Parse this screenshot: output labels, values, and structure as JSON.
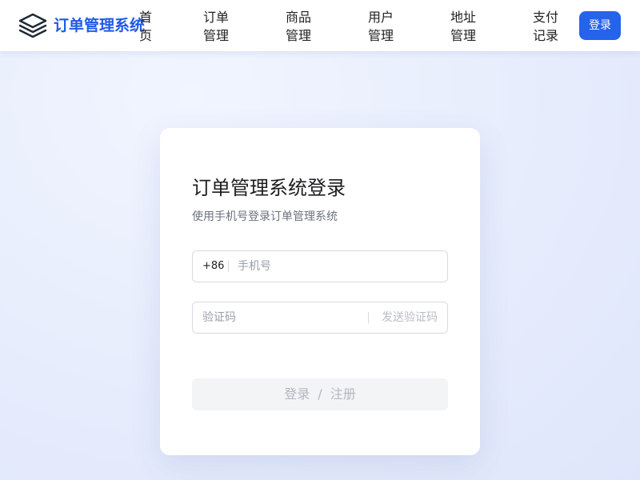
{
  "header": {
    "logo_text": "订单管理系统",
    "login_label": "登录"
  },
  "nav": {
    "items": [
      {
        "label": "首页"
      },
      {
        "label": "订单管理"
      },
      {
        "label": "商品管理"
      },
      {
        "label": "用户管理"
      },
      {
        "label": "地址管理"
      },
      {
        "label": "支付记录"
      }
    ]
  },
  "login_card": {
    "title": "订单管理系统登录",
    "subtitle": "使用手机号登录订单管理系统",
    "phone": {
      "prefix": "+86",
      "placeholder": "手机号",
      "value": ""
    },
    "code": {
      "placeholder": "验证码",
      "value": "",
      "send_label": "发送验证码"
    },
    "submit": {
      "login": "登录",
      "separator": "/",
      "register": "注册"
    }
  },
  "colors": {
    "brand": "#1f5ae6",
    "primary_button": "#2563eb",
    "disabled_text": "#b3b7bf"
  }
}
